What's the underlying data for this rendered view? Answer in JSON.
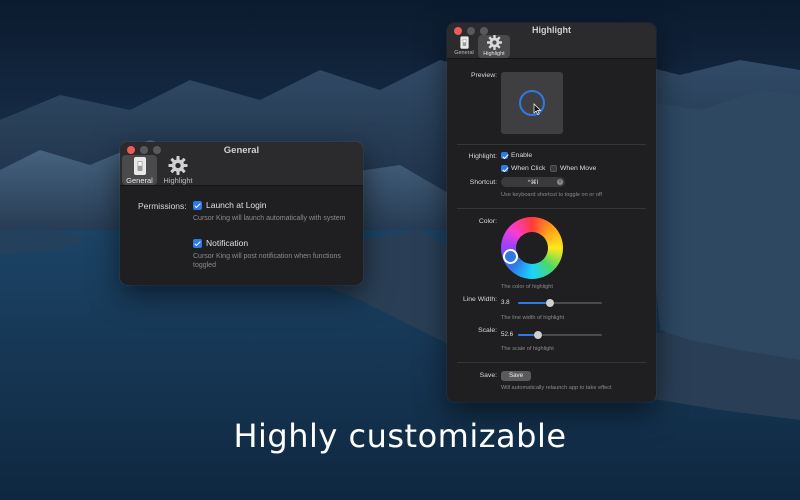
{
  "colors": {
    "accent": "#2f79e5",
    "window_bg": "#1f1f21",
    "titlebar_bg": "#2b2b2d",
    "close_red": "#ec5d57"
  },
  "general_window": {
    "title": "General",
    "tabs": [
      {
        "label": "General",
        "icon": "switch-icon",
        "active": true
      },
      {
        "label": "Highlight",
        "icon": "gear-icon",
        "active": false
      }
    ],
    "permissions_label": "Permissions:",
    "launch_at_login": {
      "label": "Launch at Login",
      "checked": true,
      "help": "Cursor King will launch automatically with system"
    },
    "notification": {
      "label": "Notification",
      "checked": true,
      "help": "Cursor King will post notification when functions toggled"
    }
  },
  "highlight_window": {
    "title": "Highlight",
    "tabs": [
      {
        "label": "General",
        "icon": "switch-icon",
        "active": false
      },
      {
        "label": "Highlight",
        "icon": "gear-icon",
        "active": true
      }
    ],
    "preview_label": "Preview:",
    "highlight_label": "Highlight:",
    "enable": {
      "label": "Enable",
      "checked": true
    },
    "when_click": {
      "label": "When Click",
      "checked": true
    },
    "when_move": {
      "label": "When Move",
      "checked": false
    },
    "shortcut_label": "Shortcut:",
    "shortcut_value": "^⌘I",
    "shortcut_help": "Use keyboard shortcut to toggle on or off",
    "color_label": "Color:",
    "color_help": "The color of highlight",
    "selected_color": "#2f79e5",
    "line_width_label": "Line Width:",
    "line_width_value": "3.8",
    "line_width_fraction": 0.38,
    "line_width_help": "The line width of highlight",
    "scale_label": "Scale:",
    "scale_value": "52.6",
    "scale_fraction": 0.24,
    "scale_help": "The scale of highlight",
    "save_label": "Save:",
    "save_button": "Save",
    "save_help": "Will automatically relaunch app to take effect"
  },
  "caption": "Highly customizable"
}
